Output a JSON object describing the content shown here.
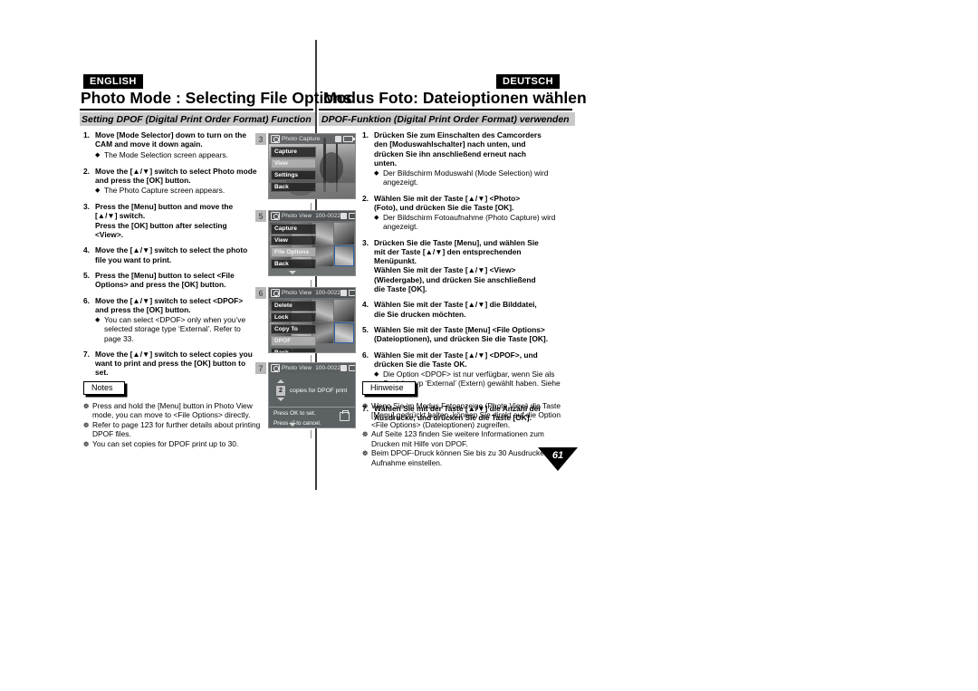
{
  "page": {
    "number": "61"
  },
  "english": {
    "lang_tag": "ENGLISH",
    "title": "Photo Mode : Selecting File Options",
    "subtitle": "Setting DPOF (Digital Print Order Format) Function",
    "steps": [
      {
        "num": "1.",
        "lines": [
          "Move [Mode Selector] down to turn on the",
          "CAM and move it down again."
        ],
        "bullets": [
          "The Mode Selection screen appears."
        ]
      },
      {
        "num": "2.",
        "lines_pre": "Move the [",
        "lines": [
          "Move the [▲/▼] switch to select Photo mode",
          "and press the [OK] button."
        ],
        "bullets": [
          "The Photo Capture screen appears."
        ]
      },
      {
        "num": "3.",
        "lines": [
          "Press the [Menu] button and move the",
          "[▲/▼] switch.",
          "Press the [OK] button after selecting <View>."
        ],
        "bullets": []
      },
      {
        "num": "4.",
        "lines": [
          "Move the [▲/▼] switch to select the photo",
          "file you want to print."
        ],
        "bullets": []
      },
      {
        "num": "5.",
        "lines": [
          "Press the [Menu] button to select <File",
          "Options> and press the [OK] button."
        ],
        "bullets": []
      },
      {
        "num": "6.",
        "lines": [
          "Move the [▲/▼] switch to select <DPOF>",
          "and press the [OK] button."
        ],
        "bullets": [
          "You can select <DPOF> only when you’ve selected storage type ‘External’. Refer to page 33."
        ]
      },
      {
        "num": "7.",
        "lines": [
          "Move the [▲/▼] switch to select copies you",
          "want to print and press the [OK] button to",
          "set."
        ],
        "bullets": []
      }
    ],
    "notes_label": "Notes",
    "notes": [
      "Press and hold the [Menu] button in Photo View mode, you can move to <File Options> directly.",
      "Refer to page 123 for further details about printing DPOF files.",
      "You can set copies for DPOF print up to 30."
    ]
  },
  "german": {
    "lang_tag": "DEUTSCH",
    "title": "Modus Foto: Dateioptionen wählen",
    "subtitle": "DPOF-Funktion (Digital Print Order Format) verwenden",
    "steps": [
      {
        "num": "1.",
        "lines": [
          "Drücken Sie zum Einschalten des Camcorders",
          "den [Moduswahlschalter] nach unten, und",
          "drücken Sie ihn anschließend erneut nach",
          "unten."
        ],
        "bullets": [
          "Der Bildschirm Moduswahl (Mode Selection) wird angezeigt."
        ]
      },
      {
        "num": "2.",
        "lines": [
          "Wählen Sie mit der Taste [▲/▼] <Photo>",
          "(Foto), und drücken Sie die Taste [OK]."
        ],
        "bullets": [
          "Der Bildschirm Fotoaufnahme (Photo Capture) wird angezeigt."
        ]
      },
      {
        "num": "3.",
        "lines": [
          "Drücken Sie die Taste [Menu], und wählen Sie",
          "mit der Taste [▲/▼] den entsprechenden",
          "Menüpunkt.",
          "Wählen Sie mit der Taste [▲/▼] <View>",
          "(Wiedergabe), und drücken Sie anschließend",
          "die Taste [OK]."
        ],
        "bullets": []
      },
      {
        "num": "4.",
        "lines": [
          "Wählen Sie mit der Taste [▲/▼] die Bilddatei,",
          "die Sie drucken möchten."
        ],
        "bullets": []
      },
      {
        "num": "5.",
        "lines": [
          "Wählen Sie mit der Taste [Menu] <File Options>",
          "(Dateioptionen), und drücken Sie die Taste [OK]."
        ],
        "bullets": []
      },
      {
        "num": "6.",
        "lines": [
          "Wählen Sie mit der Taste [▲/▼] <DPOF>, und",
          "drücken Sie die Taste OK."
        ],
        "bullets": [
          "Die Option <DPOF> ist nur verfügbar, wenn Sie als Speichertyp ‘External’ (Extern) gewählt haben. Siehe Seite 33."
        ]
      },
      {
        "num": "7.",
        "lines": [
          "Wählen Sie mit der Taste [▲/▼] die Anzahl der",
          "Ausdrucke, und drücken Sie die Taste [OK]."
        ],
        "bullets": []
      }
    ],
    "notes_label": "Hinweise",
    "notes": [
      "Wenn Sie im Modus Fotoanzeige (Photo View) die Taste [Menu] gedrückt halten, können Sie direkt auf die Option <File Options> (Dateioptionen) zugreifen.",
      "Auf Seite 123 finden Sie weitere Informationen zum Drucken mit Hilfe von DPOF.",
      "Beim DPOF-Druck können Sie bis zu 30 Ausdrucke einer Aufnahme einstellen."
    ]
  },
  "figures": [
    {
      "badge": "3",
      "screen_title": "Photo Capture",
      "file_no": "",
      "menu": [
        {
          "label": "Capture",
          "highlighted": false
        },
        {
          "label": "View",
          "highlighted": true
        },
        {
          "label": "Settings",
          "highlighted": false
        },
        {
          "label": "Back",
          "highlighted": false
        }
      ]
    },
    {
      "badge": "5",
      "screen_title": "Photo View",
      "file_no": "100-0022",
      "menu": [
        {
          "label": "Capture",
          "highlighted": false
        },
        {
          "label": "View",
          "highlighted": false
        },
        {
          "label": "File Options",
          "highlighted": true
        },
        {
          "label": "Back",
          "highlighted": false
        }
      ]
    },
    {
      "badge": "6",
      "screen_title": "Photo View",
      "file_no": "100-0022",
      "menu": [
        {
          "label": "Delete",
          "highlighted": false
        },
        {
          "label": "Lock",
          "highlighted": false
        },
        {
          "label": "Copy To",
          "highlighted": false
        },
        {
          "label": "DPOF",
          "highlighted": true
        },
        {
          "label": "Back",
          "highlighted": false
        }
      ]
    },
    {
      "badge": "7",
      "screen_title": "Photo View",
      "file_no": "100-0022",
      "dpof": {
        "count": "2",
        "label": "copies for DPOF print",
        "hint1": "Press OK to set.",
        "hint2": "Press ⏎ to cancel."
      }
    }
  ]
}
